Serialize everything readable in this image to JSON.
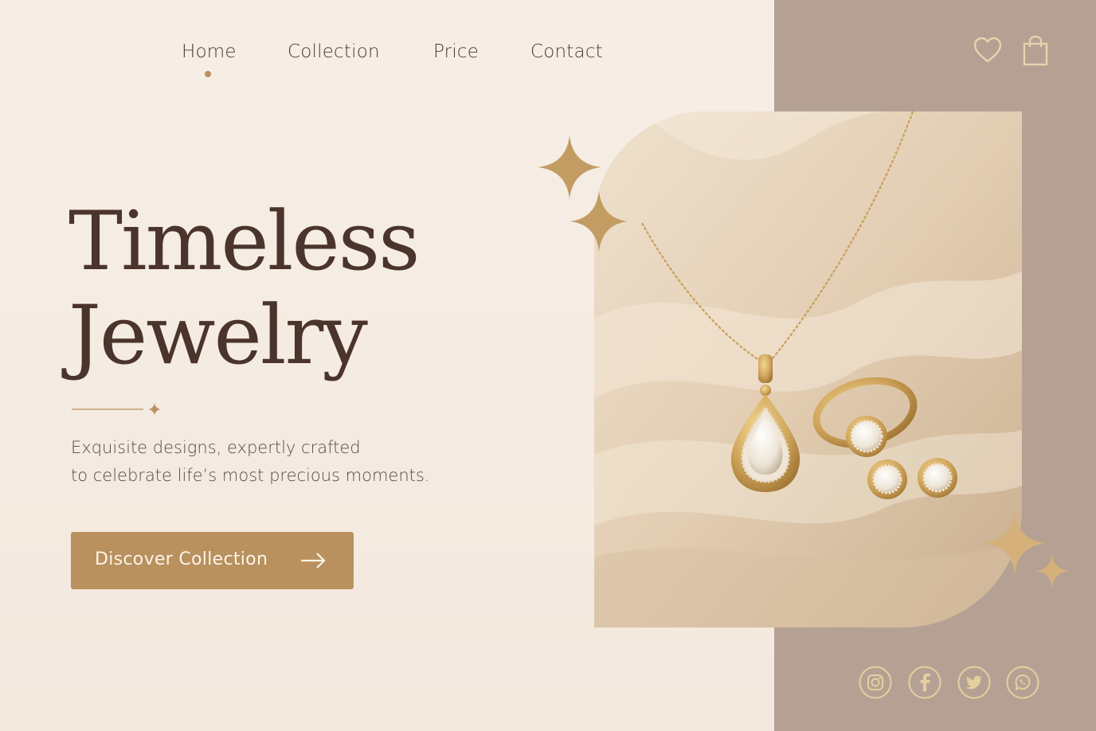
{
  "nav": {
    "items": [
      {
        "label": "Home",
        "active": true
      },
      {
        "label": "Collection",
        "active": false
      },
      {
        "label": "Price",
        "active": false
      },
      {
        "label": "Contact",
        "active": false
      }
    ]
  },
  "header_icons": [
    "heart-icon",
    "shopping-bag-icon"
  ],
  "hero": {
    "title_line1": "Timeless",
    "title_line2": "Jewelry",
    "subtitle_line1": "Exquisite designs, expertly crafted",
    "subtitle_line2": "to celebrate life’s most precious moments.",
    "cta_label": "Discover Collection"
  },
  "product_image": {
    "items": [
      "necklace",
      "ring",
      "earrings"
    ]
  },
  "social_icons": [
    "instagram-icon",
    "facebook-icon",
    "twitter-icon",
    "whatsapp-icon"
  ],
  "colors": {
    "background": "#f5ece4",
    "panel": "#b5a194",
    "accent": "#b8915e",
    "text_dark": "#4a342b"
  }
}
